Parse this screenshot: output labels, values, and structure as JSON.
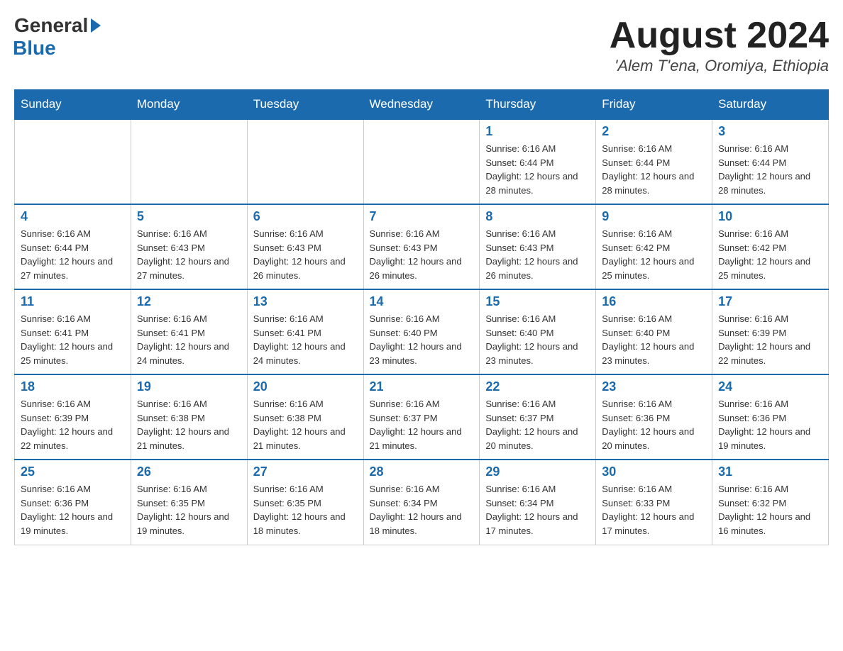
{
  "header": {
    "logo_general": "General",
    "logo_blue": "Blue",
    "main_title": "August 2024",
    "subtitle": "'Alem T'ena, Oromiya, Ethiopia"
  },
  "days_of_week": [
    "Sunday",
    "Monday",
    "Tuesday",
    "Wednesday",
    "Thursday",
    "Friday",
    "Saturday"
  ],
  "weeks": [
    [
      {
        "day": "",
        "info": ""
      },
      {
        "day": "",
        "info": ""
      },
      {
        "day": "",
        "info": ""
      },
      {
        "day": "",
        "info": ""
      },
      {
        "day": "1",
        "info": "Sunrise: 6:16 AM\nSunset: 6:44 PM\nDaylight: 12 hours and 28 minutes."
      },
      {
        "day": "2",
        "info": "Sunrise: 6:16 AM\nSunset: 6:44 PM\nDaylight: 12 hours and 28 minutes."
      },
      {
        "day": "3",
        "info": "Sunrise: 6:16 AM\nSunset: 6:44 PM\nDaylight: 12 hours and 28 minutes."
      }
    ],
    [
      {
        "day": "4",
        "info": "Sunrise: 6:16 AM\nSunset: 6:44 PM\nDaylight: 12 hours and 27 minutes."
      },
      {
        "day": "5",
        "info": "Sunrise: 6:16 AM\nSunset: 6:43 PM\nDaylight: 12 hours and 27 minutes."
      },
      {
        "day": "6",
        "info": "Sunrise: 6:16 AM\nSunset: 6:43 PM\nDaylight: 12 hours and 26 minutes."
      },
      {
        "day": "7",
        "info": "Sunrise: 6:16 AM\nSunset: 6:43 PM\nDaylight: 12 hours and 26 minutes."
      },
      {
        "day": "8",
        "info": "Sunrise: 6:16 AM\nSunset: 6:43 PM\nDaylight: 12 hours and 26 minutes."
      },
      {
        "day": "9",
        "info": "Sunrise: 6:16 AM\nSunset: 6:42 PM\nDaylight: 12 hours and 25 minutes."
      },
      {
        "day": "10",
        "info": "Sunrise: 6:16 AM\nSunset: 6:42 PM\nDaylight: 12 hours and 25 minutes."
      }
    ],
    [
      {
        "day": "11",
        "info": "Sunrise: 6:16 AM\nSunset: 6:41 PM\nDaylight: 12 hours and 25 minutes."
      },
      {
        "day": "12",
        "info": "Sunrise: 6:16 AM\nSunset: 6:41 PM\nDaylight: 12 hours and 24 minutes."
      },
      {
        "day": "13",
        "info": "Sunrise: 6:16 AM\nSunset: 6:41 PM\nDaylight: 12 hours and 24 minutes."
      },
      {
        "day": "14",
        "info": "Sunrise: 6:16 AM\nSunset: 6:40 PM\nDaylight: 12 hours and 23 minutes."
      },
      {
        "day": "15",
        "info": "Sunrise: 6:16 AM\nSunset: 6:40 PM\nDaylight: 12 hours and 23 minutes."
      },
      {
        "day": "16",
        "info": "Sunrise: 6:16 AM\nSunset: 6:40 PM\nDaylight: 12 hours and 23 minutes."
      },
      {
        "day": "17",
        "info": "Sunrise: 6:16 AM\nSunset: 6:39 PM\nDaylight: 12 hours and 22 minutes."
      }
    ],
    [
      {
        "day": "18",
        "info": "Sunrise: 6:16 AM\nSunset: 6:39 PM\nDaylight: 12 hours and 22 minutes."
      },
      {
        "day": "19",
        "info": "Sunrise: 6:16 AM\nSunset: 6:38 PM\nDaylight: 12 hours and 21 minutes."
      },
      {
        "day": "20",
        "info": "Sunrise: 6:16 AM\nSunset: 6:38 PM\nDaylight: 12 hours and 21 minutes."
      },
      {
        "day": "21",
        "info": "Sunrise: 6:16 AM\nSunset: 6:37 PM\nDaylight: 12 hours and 21 minutes."
      },
      {
        "day": "22",
        "info": "Sunrise: 6:16 AM\nSunset: 6:37 PM\nDaylight: 12 hours and 20 minutes."
      },
      {
        "day": "23",
        "info": "Sunrise: 6:16 AM\nSunset: 6:36 PM\nDaylight: 12 hours and 20 minutes."
      },
      {
        "day": "24",
        "info": "Sunrise: 6:16 AM\nSunset: 6:36 PM\nDaylight: 12 hours and 19 minutes."
      }
    ],
    [
      {
        "day": "25",
        "info": "Sunrise: 6:16 AM\nSunset: 6:36 PM\nDaylight: 12 hours and 19 minutes."
      },
      {
        "day": "26",
        "info": "Sunrise: 6:16 AM\nSunset: 6:35 PM\nDaylight: 12 hours and 19 minutes."
      },
      {
        "day": "27",
        "info": "Sunrise: 6:16 AM\nSunset: 6:35 PM\nDaylight: 12 hours and 18 minutes."
      },
      {
        "day": "28",
        "info": "Sunrise: 6:16 AM\nSunset: 6:34 PM\nDaylight: 12 hours and 18 minutes."
      },
      {
        "day": "29",
        "info": "Sunrise: 6:16 AM\nSunset: 6:34 PM\nDaylight: 12 hours and 17 minutes."
      },
      {
        "day": "30",
        "info": "Sunrise: 6:16 AM\nSunset: 6:33 PM\nDaylight: 12 hours and 17 minutes."
      },
      {
        "day": "31",
        "info": "Sunrise: 6:16 AM\nSunset: 6:32 PM\nDaylight: 12 hours and 16 minutes."
      }
    ]
  ]
}
